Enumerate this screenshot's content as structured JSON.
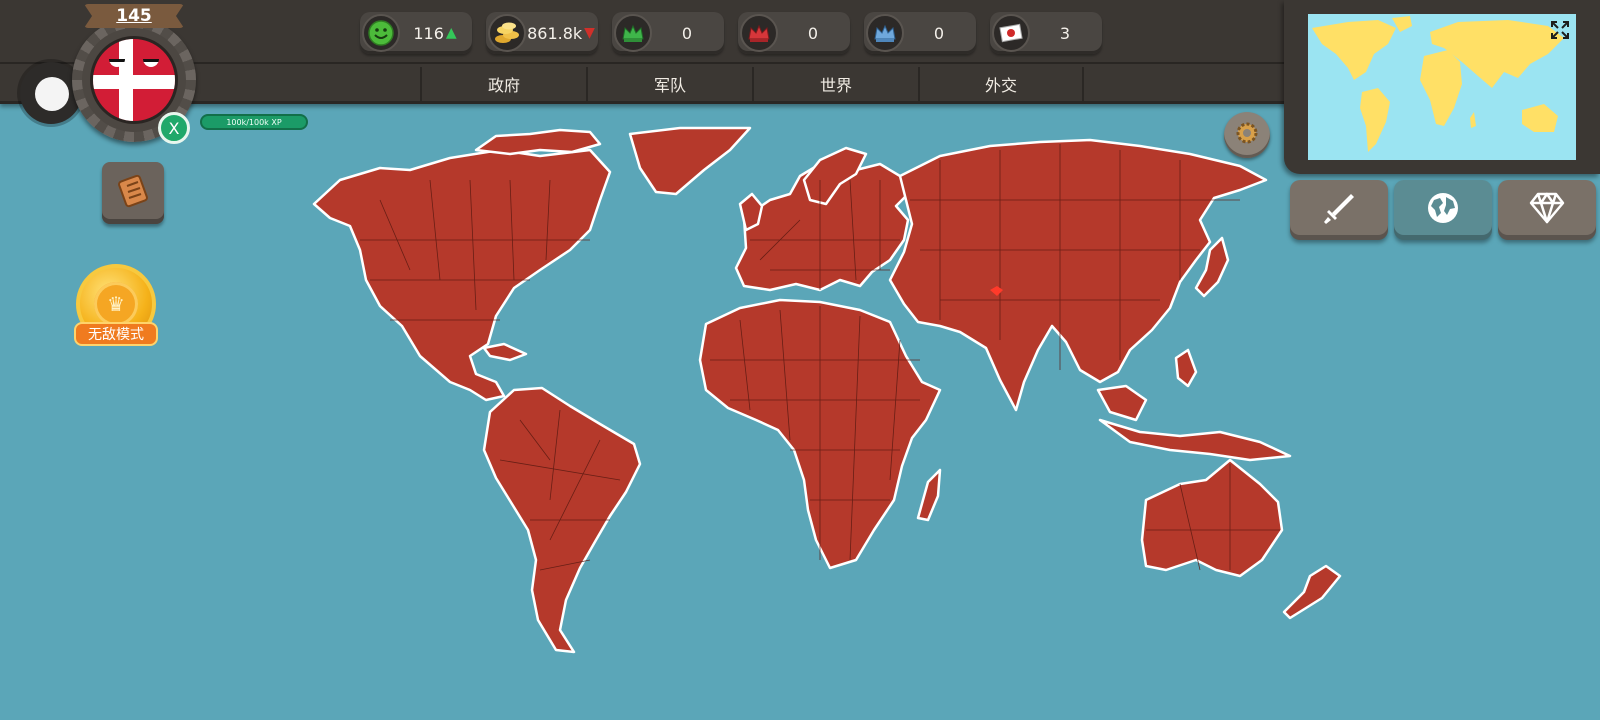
{
  "player": {
    "level": "145",
    "xp_label": "100k/100k XP",
    "x_button_label": "X",
    "country_flag": "denmark"
  },
  "resources": [
    {
      "id": "happiness",
      "icon": "smiley-icon",
      "value": "116",
      "trend": "up"
    },
    {
      "id": "money",
      "icon": "coins-icon",
      "value": "861.8k",
      "trend": "down"
    },
    {
      "id": "green-crown",
      "icon": "green-crown-icon",
      "value": "0",
      "trend": ""
    },
    {
      "id": "red-crown",
      "icon": "red-crown-icon",
      "value": "0",
      "trend": ""
    },
    {
      "id": "blue-crown",
      "icon": "blue-crown-icon",
      "value": "0",
      "trend": ""
    },
    {
      "id": "japan-flag",
      "icon": "japan-flag-icon",
      "value": "3",
      "trend": ""
    }
  ],
  "tabs": [
    "政府",
    "军队",
    "世界",
    "外交"
  ],
  "invincible_mode": {
    "label": "无敌模式"
  },
  "colors": {
    "ocean": "#5ba6b8",
    "territory": "#b5392b",
    "topbar": "#3b3733",
    "minimap_land": "#ffe066",
    "minimap_sea": "#9be4f2"
  }
}
